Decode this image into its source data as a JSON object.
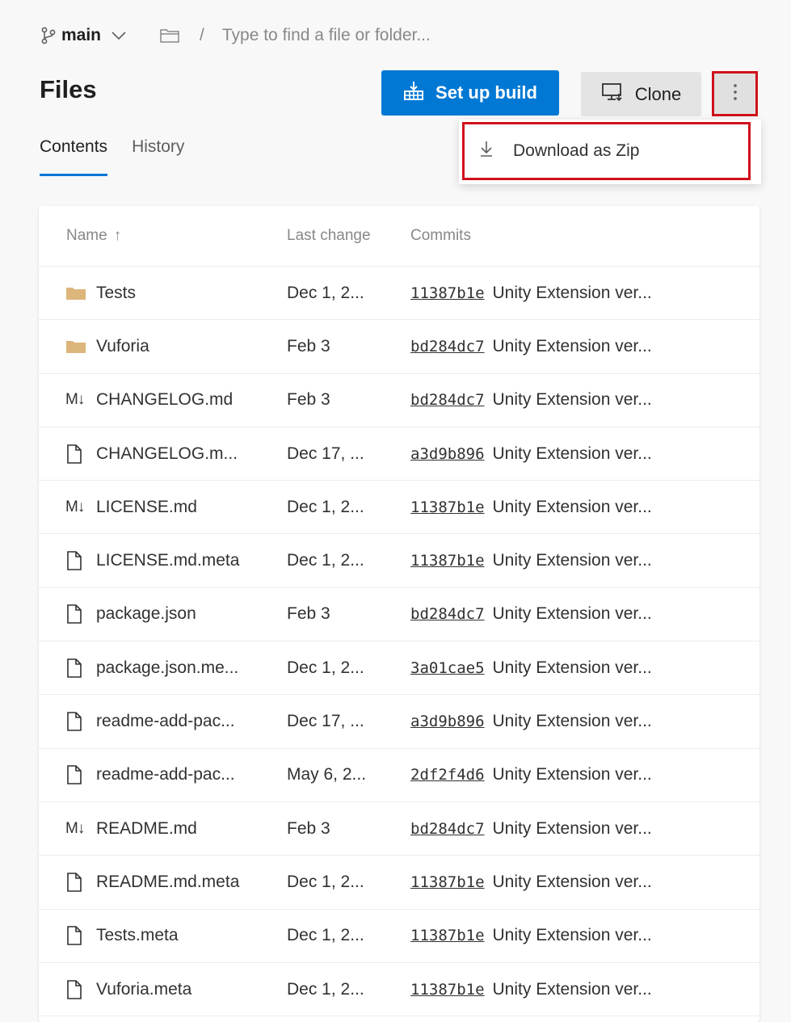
{
  "topbar": {
    "branch": "main",
    "path_separator": "/",
    "path_placeholder": "Type to find a file or folder..."
  },
  "page_title": "Files",
  "actions": {
    "setup_build": "Set up build",
    "clone": "Clone",
    "more_menu": {
      "items": [
        {
          "label": "Download as Zip",
          "icon": "download-icon"
        }
      ]
    }
  },
  "tabs": [
    {
      "label": "Contents",
      "active": true
    },
    {
      "label": "History",
      "active": false
    }
  ],
  "table": {
    "columns": {
      "name": "Name",
      "sort_indicator": "↑",
      "last_change": "Last change",
      "commits": "Commits"
    },
    "rows": [
      {
        "type": "folder",
        "name": "Tests",
        "date": "Dec 1, 2...",
        "hash": "11387b1e",
        "message": "Unity Extension ver..."
      },
      {
        "type": "folder",
        "name": "Vuforia",
        "date": "Feb 3",
        "hash": "bd284dc7",
        "message": "Unity Extension ver..."
      },
      {
        "type": "markdown",
        "name": "CHANGELOG.md",
        "date": "Feb 3",
        "hash": "bd284dc7",
        "message": "Unity Extension ver..."
      },
      {
        "type": "file",
        "name": "CHANGELOG.m...",
        "date": "Dec 17, ...",
        "hash": "a3d9b896",
        "message": "Unity Extension ver..."
      },
      {
        "type": "markdown",
        "name": "LICENSE.md",
        "date": "Dec 1, 2...",
        "hash": "11387b1e",
        "message": "Unity Extension ver..."
      },
      {
        "type": "file",
        "name": "LICENSE.md.meta",
        "date": "Dec 1, 2...",
        "hash": "11387b1e",
        "message": "Unity Extension ver..."
      },
      {
        "type": "file",
        "name": "package.json",
        "date": "Feb 3",
        "hash": "bd284dc7",
        "message": "Unity Extension ver..."
      },
      {
        "type": "file",
        "name": "package.json.me...",
        "date": "Dec 1, 2...",
        "hash": "3a01cae5",
        "message": "Unity Extension ver..."
      },
      {
        "type": "file",
        "name": "readme-add-pac...",
        "date": "Dec 17, ...",
        "hash": "a3d9b896",
        "message": "Unity Extension ver..."
      },
      {
        "type": "file",
        "name": "readme-add-pac...",
        "date": "May 6, 2...",
        "hash": "2df2f4d6",
        "message": "Unity Extension ver..."
      },
      {
        "type": "markdown",
        "name": "README.md",
        "date": "Feb 3",
        "hash": "bd284dc7",
        "message": "Unity Extension ver..."
      },
      {
        "type": "file",
        "name": "README.md.meta",
        "date": "Dec 1, 2...",
        "hash": "11387b1e",
        "message": "Unity Extension ver..."
      },
      {
        "type": "file",
        "name": "Tests.meta",
        "date": "Dec 1, 2...",
        "hash": "11387b1e",
        "message": "Unity Extension ver..."
      },
      {
        "type": "file",
        "name": "Vuforia.meta",
        "date": "Dec 1, 2...",
        "hash": "11387b1e",
        "message": "Unity Extension ver..."
      }
    ]
  },
  "icons": {
    "markdown_glyph": "M↓"
  },
  "colors": {
    "primary": "#0078d4",
    "highlight_border": "#d0111b",
    "folder": "#dcb67a"
  }
}
